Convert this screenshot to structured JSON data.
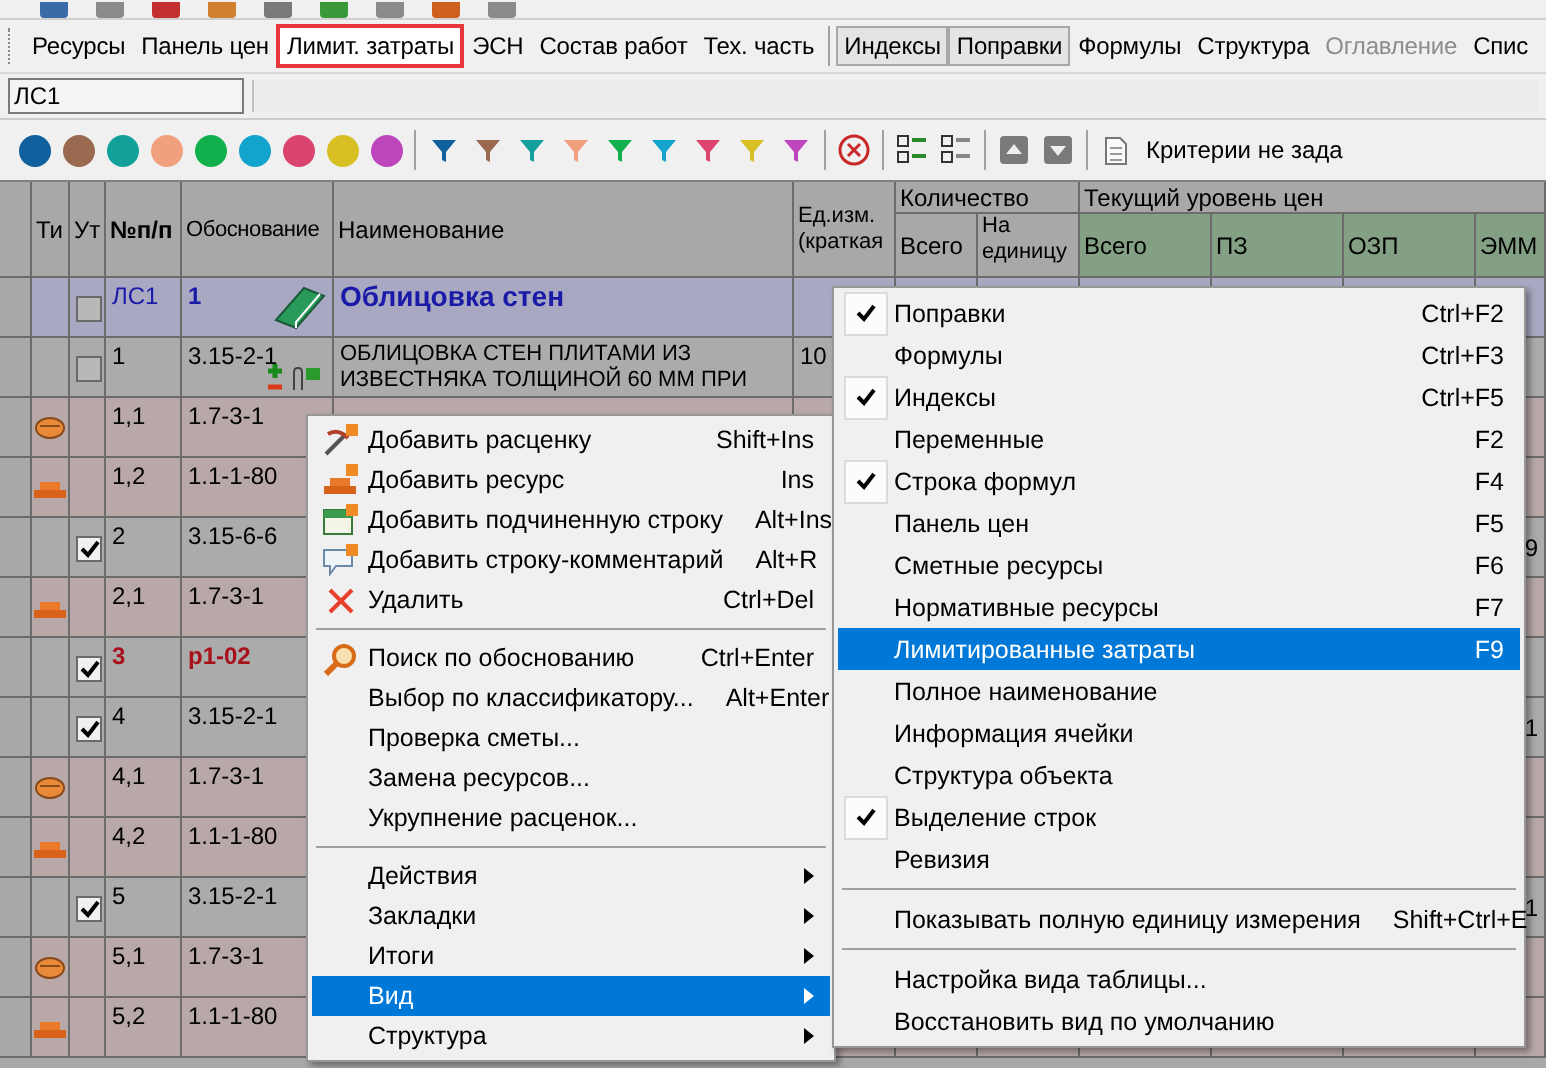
{
  "tabs": [
    {
      "kind": "tab",
      "label": "Ресурсы",
      "pressed": false,
      "highlighted": false,
      "disabled": false
    },
    {
      "kind": "tab",
      "label": "Панель цен",
      "pressed": false,
      "highlighted": false,
      "disabled": false
    },
    {
      "kind": "tab",
      "label": "Лимит. затраты",
      "pressed": false,
      "highlighted": true,
      "disabled": false
    },
    {
      "kind": "tab",
      "label": "ЭСН",
      "pressed": false,
      "highlighted": false,
      "disabled": false
    },
    {
      "kind": "tab",
      "label": "Состав работ",
      "pressed": false,
      "highlighted": false,
      "disabled": false
    },
    {
      "kind": "tab",
      "label": "Тех. часть",
      "pressed": false,
      "highlighted": false,
      "disabled": false
    },
    {
      "kind": "separator"
    },
    {
      "kind": "tab",
      "label": "Индексы",
      "pressed": true,
      "highlighted": false,
      "disabled": false
    },
    {
      "kind": "tab",
      "label": "Поправки",
      "pressed": true,
      "highlighted": false,
      "disabled": false
    },
    {
      "kind": "tab",
      "label": "Формулы",
      "pressed": false,
      "highlighted": false,
      "disabled": false
    },
    {
      "kind": "tab",
      "label": "Структура",
      "pressed": false,
      "highlighted": false,
      "disabled": false
    },
    {
      "kind": "tab",
      "label": "Оглавление",
      "pressed": false,
      "highlighted": false,
      "disabled": true
    },
    {
      "kind": "tab",
      "label": "Спис",
      "pressed": false,
      "highlighted": false,
      "disabled": false
    }
  ],
  "formula_bar": {
    "cell": "ЛС1"
  },
  "filter_toolbar": {
    "marks": [
      {
        "color": "#11609e"
      },
      {
        "color": "#9a6a50"
      },
      {
        "color": "#14a09a"
      },
      {
        "color": "#f0a07c"
      },
      {
        "color": "#12b04c"
      },
      {
        "color": "#12a4cc"
      },
      {
        "color": "#dc4470"
      },
      {
        "color": "#d8c024"
      },
      {
        "color": "#be46bc"
      }
    ],
    "filters": [
      {
        "color": "#11609e"
      },
      {
        "color": "#9a6a50"
      },
      {
        "color": "#14a09a"
      },
      {
        "color": "#f0a07c"
      },
      {
        "color": "#12b04c"
      },
      {
        "color": "#12a4cc"
      },
      {
        "color": "#dc4470"
      },
      {
        "color": "#d8c024"
      },
      {
        "color": "#be46bc"
      }
    ],
    "criteria": "Критерии не зада"
  },
  "table": {
    "columns": {
      "type": "Ти",
      "check": "Ут",
      "number": "№п/п",
      "basis": "Обоснование",
      "name": "Наименование",
      "unit": "Ед.изм. (краткая",
      "quantity": "Количество",
      "quantity_total": "Всего",
      "quantity_per_unit": "На единицу",
      "price_level": "Текущий уровень цен",
      "price_total": "Всего",
      "pz": "ПЗ",
      "ozp": "ОЗП",
      "emm": "ЭММ"
    },
    "rows": [
      {
        "kind": "estimate",
        "checked": false,
        "number": "ЛС1",
        "basis": "1",
        "name": "Облицовка стен"
      },
      {
        "kind": "work",
        "checked": false,
        "number": "1",
        "basis": "3.15-2-1",
        "name": "ОБЛИЦОВКА СТЕН ПЛИТАМИ ИЗ ИЗВЕСТНЯКА ТОЛЩИНОЙ 60 ММ ПРИ",
        "unit": "10"
      },
      {
        "kind": "machine",
        "number": "1,1",
        "basis": "1.7-3-1"
      },
      {
        "kind": "material",
        "number": "1,2",
        "basis": "1.1-1-80"
      },
      {
        "kind": "work",
        "checked": true,
        "number": "2",
        "basis": "3.15-6-6",
        "emm": "9"
      },
      {
        "kind": "material",
        "number": "2,1",
        "basis": "1.7-3-1"
      },
      {
        "kind": "section",
        "checked": true,
        "number": "3",
        "basis": "р1-02"
      },
      {
        "kind": "work",
        "checked": true,
        "number": "4",
        "basis": "3.15-2-1",
        "emm": "1"
      },
      {
        "kind": "machine",
        "number": "4,1",
        "basis": "1.7-3-1"
      },
      {
        "kind": "material",
        "number": "4,2",
        "basis": "1.1-1-80"
      },
      {
        "kind": "work",
        "checked": true,
        "number": "5",
        "basis": "3.15-2-1",
        "emm": "1"
      },
      {
        "kind": "machine",
        "number": "5,1",
        "basis": "1.7-3-1"
      },
      {
        "kind": "material",
        "number": "5,2",
        "basis": "1.1-1-80"
      }
    ]
  },
  "context_menu": {
    "items": [
      {
        "kind": "item",
        "label": "Добавить расценку",
        "shortcut": "Shift+Ins",
        "selected": false
      },
      {
        "kind": "item",
        "label": "Добавить ресурс",
        "shortcut": "Ins",
        "selected": false
      },
      {
        "kind": "item",
        "label": "Добавить подчиненную строку",
        "shortcut": "Alt+Ins",
        "selected": false
      },
      {
        "kind": "item",
        "label": "Добавить строку-комментарий",
        "shortcut": "Alt+R",
        "selected": false
      },
      {
        "kind": "item",
        "label": "Удалить",
        "shortcut": "Ctrl+Del",
        "selected": false
      },
      {
        "kind": "separator"
      },
      {
        "kind": "item",
        "label": "Поиск по обоснованию",
        "shortcut": "Ctrl+Enter",
        "selected": false
      },
      {
        "kind": "item",
        "label": "Выбор по классификатору...",
        "shortcut": "Alt+Enter",
        "selected": false
      },
      {
        "kind": "item",
        "label": "Проверка сметы...",
        "selected": false
      },
      {
        "kind": "item",
        "label": "Замена ресурсов...",
        "selected": false
      },
      {
        "kind": "item",
        "label": "Укрупнение расценок...",
        "selected": false
      },
      {
        "kind": "separator"
      },
      {
        "kind": "submenu",
        "label": "Действия",
        "selected": false
      },
      {
        "kind": "submenu",
        "label": "Закладки",
        "selected": false
      },
      {
        "kind": "submenu",
        "label": "Итоги",
        "selected": false
      },
      {
        "kind": "submenu",
        "label": "Вид",
        "selected": true
      },
      {
        "kind": "submenu",
        "label": "Структура",
        "selected": false
      }
    ]
  },
  "view_submenu": {
    "items": [
      {
        "kind": "item",
        "label": "Поправки",
        "shortcut": "Ctrl+F2",
        "checked": true,
        "selected": false
      },
      {
        "kind": "item",
        "label": "Формулы",
        "shortcut": "Ctrl+F3",
        "checked": false,
        "selected": false
      },
      {
        "kind": "item",
        "label": "Индексы",
        "shortcut": "Ctrl+F5",
        "checked": true,
        "selected": false
      },
      {
        "kind": "item",
        "label": "Переменные",
        "shortcut": "F2",
        "checked": false,
        "selected": false
      },
      {
        "kind": "item",
        "label": "Строка формул",
        "shortcut": "F4",
        "checked": true,
        "selected": false
      },
      {
        "kind": "item",
        "label": "Панель цен",
        "shortcut": "F5",
        "checked": false,
        "selected": false
      },
      {
        "kind": "item",
        "label": "Сметные ресурсы",
        "shortcut": "F6",
        "checked": false,
        "selected": false
      },
      {
        "kind": "item",
        "label": "Нормативные ресурсы",
        "shortcut": "F7",
        "checked": false,
        "selected": false
      },
      {
        "kind": "item",
        "label": "Лимитированные затраты",
        "shortcut": "F9",
        "checked": false,
        "selected": true
      },
      {
        "kind": "item",
        "label": "Полное наименование",
        "checked": false,
        "selected": false
      },
      {
        "kind": "item",
        "label": "Информация ячейки",
        "checked": false,
        "selected": false
      },
      {
        "kind": "item",
        "label": "Структура объекта",
        "checked": false,
        "selected": false
      },
      {
        "kind": "item",
        "label": "Выделение строк",
        "checked": true,
        "selected": false
      },
      {
        "kind": "item",
        "label": "Ревизия",
        "checked": false,
        "selected": false
      },
      {
        "kind": "separator"
      },
      {
        "kind": "item",
        "label": "Показывать полную единицу измерения",
        "shortcut": "Shift+Ctrl+E",
        "checked": false,
        "selected": false
      },
      {
        "kind": "separator"
      },
      {
        "kind": "item",
        "label": "Настройка вида таблицы...",
        "checked": false,
        "selected": false
      },
      {
        "kind": "item",
        "label": "Восстановить вид по умолчанию",
        "checked": false,
        "selected": false
      }
    ]
  }
}
